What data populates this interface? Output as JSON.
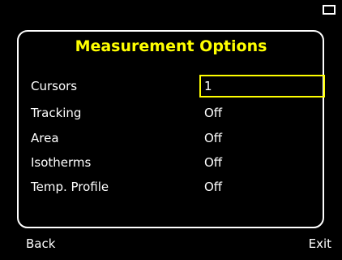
{
  "status_bar": {
    "battery_icon": "battery-icon"
  },
  "dialog": {
    "title": "Measurement Options",
    "options": [
      {
        "label": "Cursors",
        "value": "1",
        "selected": true
      },
      {
        "label": "Tracking",
        "value": "Off",
        "selected": false
      },
      {
        "label": "Area",
        "value": "Off",
        "selected": false
      },
      {
        "label": "Isotherms",
        "value": "Off",
        "selected": false
      },
      {
        "label": "Temp. Profile",
        "value": "Off",
        "selected": false
      }
    ]
  },
  "softkeys": {
    "left": "Back",
    "right": "Exit"
  },
  "colors": {
    "background": "#000000",
    "text": "#ffffff",
    "accent": "#ffff00"
  }
}
